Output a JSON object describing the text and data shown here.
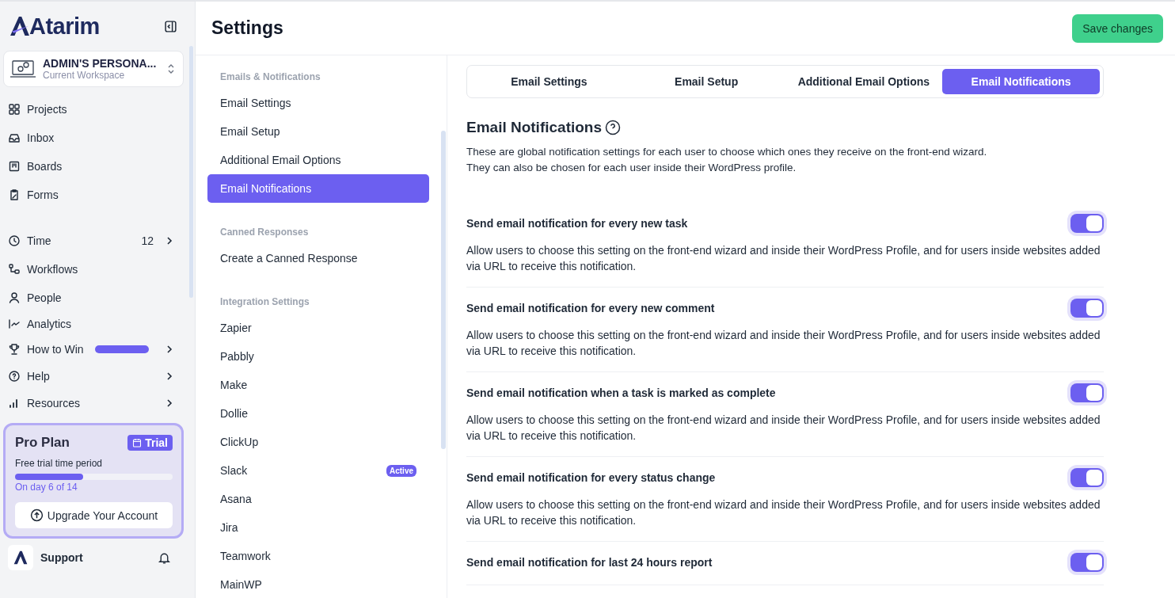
{
  "sidebar": {
    "logo": "Atarim",
    "workspace": {
      "name": "ADMIN'S PERSONA...",
      "caption": "Current Workspace"
    },
    "primary_items": [
      {
        "label": "Projects"
      },
      {
        "label": "Inbox"
      },
      {
        "label": "Boards"
      },
      {
        "label": "Forms"
      }
    ],
    "secondary_items": [
      {
        "label": "Time",
        "count": "12",
        "chevron": true
      },
      {
        "label": "Workflows"
      },
      {
        "label": "People"
      },
      {
        "label": "Analytics"
      },
      {
        "label": "How to Win",
        "progress": true,
        "chevron": true
      },
      {
        "label": "Help",
        "chevron": true
      },
      {
        "label": "Resources",
        "chevron": true
      }
    ],
    "plan": {
      "title": "Pro Plan",
      "badge": "Trial",
      "caption": "Free trial time period",
      "level": 0.43,
      "progress_text": "On day 6 of 14",
      "button": "Upgrade Your Account"
    },
    "footer": {
      "label": "Support"
    }
  },
  "header": {
    "title": "Settings",
    "save": "Save changes"
  },
  "settings_nav": [
    {
      "heading": "Emails & Notifications",
      "items": [
        {
          "label": "Email Settings",
          "selected": false
        },
        {
          "label": "Email Setup",
          "selected": false
        },
        {
          "label": "Additional Email Options",
          "selected": false
        },
        {
          "label": "Email Notifications",
          "selected": true
        }
      ]
    },
    {
      "heading": "Canned Responses",
      "items": [
        {
          "label": "Create a Canned Response",
          "selected": false
        }
      ]
    },
    {
      "heading": "Integration Settings",
      "items": [
        {
          "label": "Zapier",
          "selected": false
        },
        {
          "label": "Pabbly",
          "selected": false
        },
        {
          "label": "Make",
          "selected": false
        },
        {
          "label": "Dollie",
          "selected": false
        },
        {
          "label": "ClickUp",
          "selected": false
        },
        {
          "label": "Slack",
          "selected": false,
          "badge": "Active"
        },
        {
          "label": "Asana",
          "selected": false
        },
        {
          "label": "Jira",
          "selected": false
        },
        {
          "label": "Teamwork",
          "selected": false
        },
        {
          "label": "MainWP",
          "selected": false
        }
      ]
    }
  ],
  "tabs": [
    {
      "label": "Email Settings",
      "selected": false
    },
    {
      "label": "Email Setup",
      "selected": false
    },
    {
      "label": "Additional Email Options",
      "selected": false
    },
    {
      "label": "Email Notifications",
      "selected": true
    }
  ],
  "section": {
    "title": "Email Notifications",
    "description": [
      "These are global notification settings for each user to choose which ones they receive on the front-end wizard.",
      "They can also be chosen for each user inside their WordPress profile."
    ]
  },
  "notifications": [
    {
      "title": "Send email notification for every new task",
      "description": "Allow users to choose this setting on the front-end wizard and inside their WordPress Profile, and for users inside websites added via URL to receive this notification.",
      "on": true
    },
    {
      "title": "Send email notification for every new comment",
      "description": "Allow users to choose this setting on the front-end wizard and inside their WordPress Profile, and for users inside websites added via URL to receive this notification.",
      "on": true
    },
    {
      "title": "Send email notification when a task is marked as complete",
      "description": "Allow users to choose this setting on the front-end wizard and inside their WordPress Profile, and for users inside websites added via URL to receive this notification.",
      "on": true
    },
    {
      "title": "Send email notification for every status change",
      "description": "Allow users to choose this setting on the front-end wizard and inside their WordPress Profile, and for users inside websites added via URL to receive this notification.",
      "on": true
    },
    {
      "title": "Send email notification for last 24 hours report",
      "on": true
    }
  ]
}
